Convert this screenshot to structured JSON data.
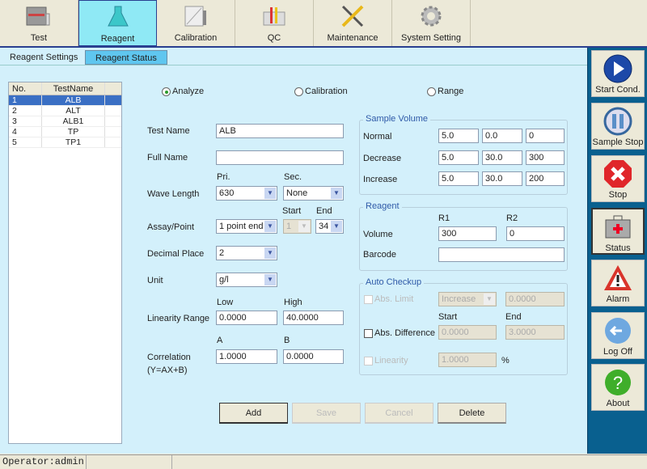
{
  "toolbar": {
    "tabs": [
      {
        "label": "Test",
        "icon": "test-icon"
      },
      {
        "label": "Reagent",
        "icon": "flask-icon",
        "selected": true
      },
      {
        "label": "Calibration",
        "icon": "calibration-icon"
      },
      {
        "label": "QC",
        "icon": "qc-icon"
      },
      {
        "label": "Maintenance",
        "icon": "tools-icon"
      },
      {
        "label": "System Setting",
        "icon": "gear-icon"
      }
    ]
  },
  "subtabs": [
    "Reagent Settings",
    "Reagent Status"
  ],
  "list": {
    "headers": [
      "No.",
      "TestName"
    ],
    "rows": [
      [
        "1",
        "ALB"
      ],
      [
        "2",
        "ALT"
      ],
      [
        "3",
        "ALB1"
      ],
      [
        "4",
        "TP"
      ],
      [
        "5",
        "TP1"
      ]
    ],
    "selected": 0
  },
  "mode": {
    "options": [
      "Analyze",
      "Calibration",
      "Range"
    ],
    "selected": "Analyze"
  },
  "form": {
    "test_name": {
      "label": "Test Name",
      "value": "ALB"
    },
    "full_name": {
      "label": "Full Name",
      "value": ""
    },
    "wave": {
      "label": "Wave Length",
      "pri_label": "Pri.",
      "sec_label": "Sec.",
      "pri": "630",
      "sec": "None"
    },
    "assay": {
      "label": "Assay/Point",
      "value": "1 point end",
      "start_label": "Start",
      "end_label": "End",
      "start": "1",
      "end": "34"
    },
    "decimal": {
      "label": "Decimal Place",
      "value": "2"
    },
    "unit": {
      "label": "Unit",
      "value": "g/l"
    },
    "linearity": {
      "label": "Linearity Range",
      "low_label": "Low",
      "high_label": "High",
      "low": "0.0000",
      "high": "40.0000"
    },
    "correlation": {
      "label": "Correlation",
      "sub": "(Y=AX+B)",
      "a_label": "A",
      "b_label": "B",
      "a": "1.0000",
      "b": "0.0000"
    }
  },
  "sample_volume": {
    "title": "Sample Volume",
    "rows": [
      {
        "label": "Normal",
        "values": [
          "5.0",
          "0.0",
          "0"
        ]
      },
      {
        "label": "Decrease",
        "values": [
          "5.0",
          "30.0",
          "300"
        ]
      },
      {
        "label": "Increase",
        "values": [
          "5.0",
          "30.0",
          "200"
        ]
      }
    ]
  },
  "reagent": {
    "title": "Reagent",
    "r1_label": "R1",
    "r2_label": "R2",
    "volume_label": "Volume",
    "r1": "300",
    "r2": "0",
    "barcode_label": "Barcode",
    "barcode": ""
  },
  "auto_checkup": {
    "title": "Auto Checkup",
    "abs_limit": {
      "label": "Abs. Limit",
      "mode": "Increase",
      "value": "0.0000"
    },
    "start_label": "Start",
    "end_label": "End",
    "abs_diff": {
      "label": "Abs. Difference",
      "start": "0.0000",
      "end": "3.0000"
    },
    "linearity": {
      "label": "Linearity",
      "value": "1.0000",
      "unit": "%"
    }
  },
  "actions": {
    "add": "Add",
    "save": "Save",
    "cancel": "Cancel",
    "delete": "Delete"
  },
  "sidebar": [
    {
      "label": "Start Cond.",
      "icon": "play-icon"
    },
    {
      "label": "Sample Stop",
      "icon": "pause-icon"
    },
    {
      "label": "Stop",
      "icon": "stop-icon"
    },
    {
      "label": "Status",
      "icon": "first-aid-case-icon"
    },
    {
      "label": "Alarm",
      "icon": "warning-icon"
    },
    {
      "label": "Log Off",
      "icon": "logoff-icon"
    },
    {
      "label": "About",
      "icon": "help-icon"
    }
  ],
  "status": {
    "operator": "Operator:admin"
  }
}
